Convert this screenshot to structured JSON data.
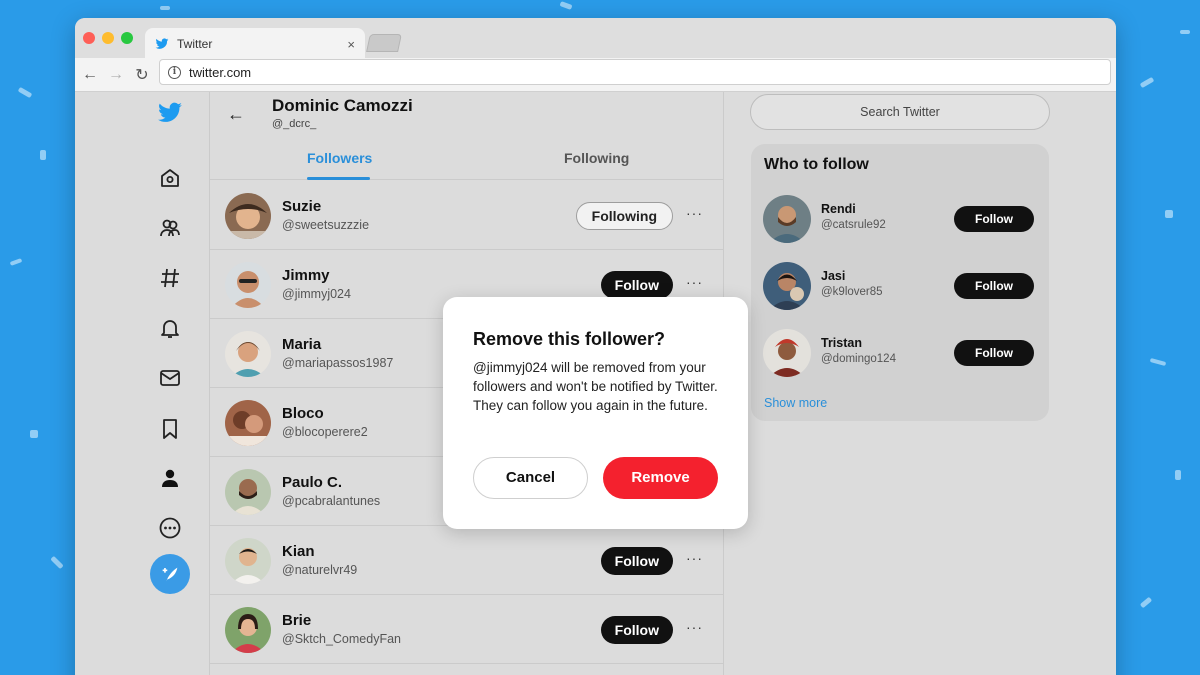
{
  "browser": {
    "tab_title": "Twitter",
    "tab_close": "×",
    "url": "twitter.com",
    "back_glyph": "←",
    "forward_glyph": "→",
    "reload_glyph": "↻"
  },
  "nav": {
    "items": [
      "twitter-logo-icon",
      "home-icon",
      "explore-icon",
      "hashtag-icon",
      "bell-icon",
      "mail-icon",
      "bookmark-icon",
      "profile-icon",
      "more-icon"
    ],
    "compose_icon": "feather-plus-icon"
  },
  "profile": {
    "back_glyph": "←",
    "name": "Dominic Camozzi",
    "handle": "@_dcrc_",
    "tabs": [
      {
        "label": "Followers",
        "active": true
      },
      {
        "label": "Following",
        "active": false
      }
    ]
  },
  "followers": [
    {
      "name": "Suzie",
      "handle": "@sweetsuzzzie",
      "button": "Following",
      "more": "···"
    },
    {
      "name": "Jimmy",
      "handle": "@jimmyj024",
      "button": "Follow",
      "more": "···"
    },
    {
      "name": "Maria",
      "handle": "@mariapassos1987",
      "button": "",
      "more": ""
    },
    {
      "name": "Bloco",
      "handle": "@blocoperere2",
      "button": "",
      "more": ""
    },
    {
      "name": "Paulo C.",
      "handle": "@pcabralantunes",
      "button": "",
      "more": ""
    },
    {
      "name": "Kian",
      "handle": "@naturelvr49",
      "button": "Follow",
      "more": "···"
    },
    {
      "name": "Brie",
      "handle": "@Sktch_ComedyFan",
      "button": "Follow",
      "more": "···"
    }
  ],
  "sidebar": {
    "search_placeholder": "Search Twitter",
    "who_to_follow_title": "Who to follow",
    "suggestions": [
      {
        "name": "Rendi",
        "handle": "@catsrule92",
        "button": "Follow"
      },
      {
        "name": "Jasi",
        "handle": "@k9lover85",
        "button": "Follow"
      },
      {
        "name": "Tristan",
        "handle": "@domingo124",
        "button": "Follow"
      }
    ],
    "show_more": "Show more"
  },
  "modal": {
    "title": "Remove this follower?",
    "body": "@jimmyj024 will be removed from your followers and won't be notified by Twitter. They can follow you again in the future.",
    "cancel": "Cancel",
    "remove": "Remove"
  },
  "colors": {
    "twitter_blue": "#2a9be8",
    "link_blue": "#2a8fd9",
    "remove_red": "#f4212e"
  }
}
